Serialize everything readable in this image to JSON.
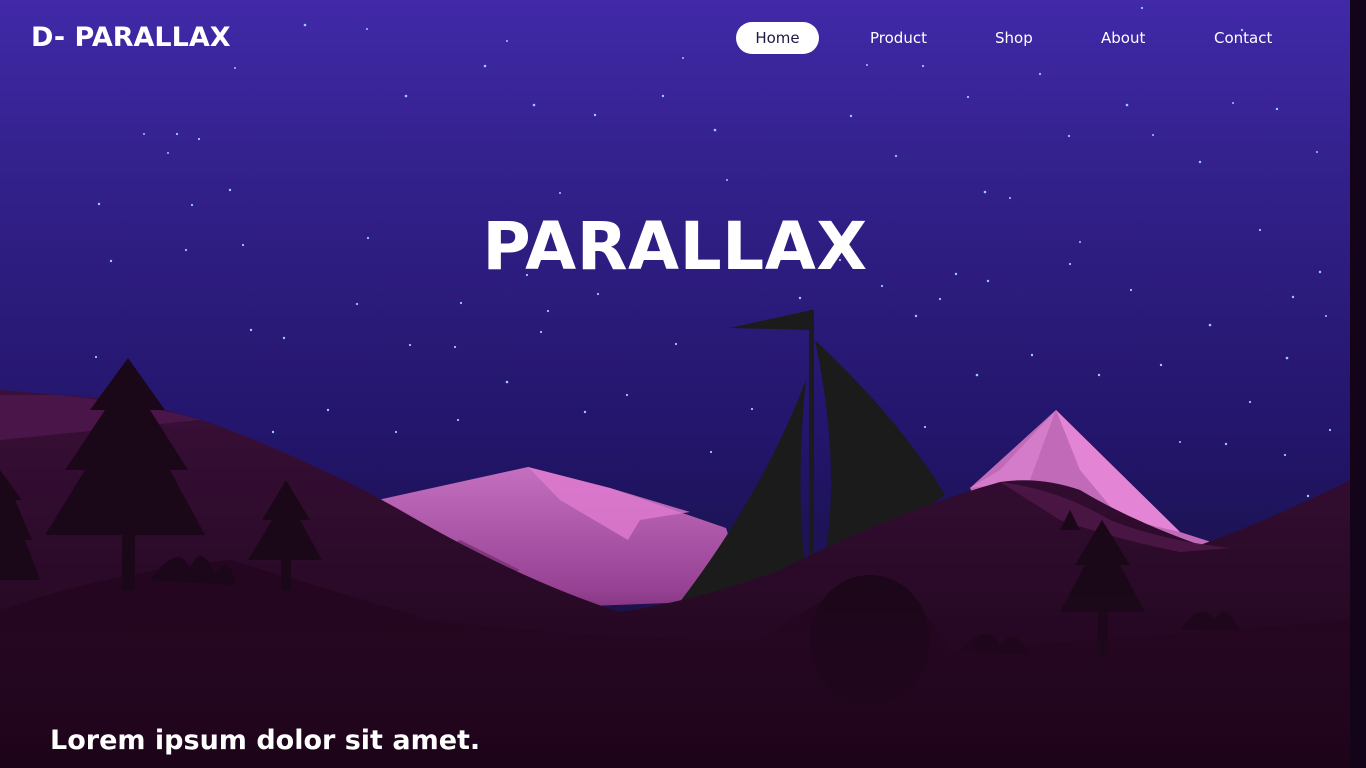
{
  "header": {
    "logo": "D- PARALLAX"
  },
  "nav": {
    "items": [
      {
        "label": "Home",
        "active": true
      },
      {
        "label": "Product",
        "active": false
      },
      {
        "label": "Shop",
        "active": false
      },
      {
        "label": "About",
        "active": false
      },
      {
        "label": "Contact",
        "active": false
      }
    ]
  },
  "hero": {
    "title": "PARALLAX"
  },
  "section": {
    "heading": "Lorem ipsum dolor sit amet."
  },
  "colors": {
    "sky_top": "#4129a8",
    "sky_bottom": "#1a1046",
    "mountain_pink": "#d870c8",
    "hill_dark": "#2a0a26",
    "silhouette": "#1b1b1b",
    "nav_active_bg": "#ffffff"
  }
}
